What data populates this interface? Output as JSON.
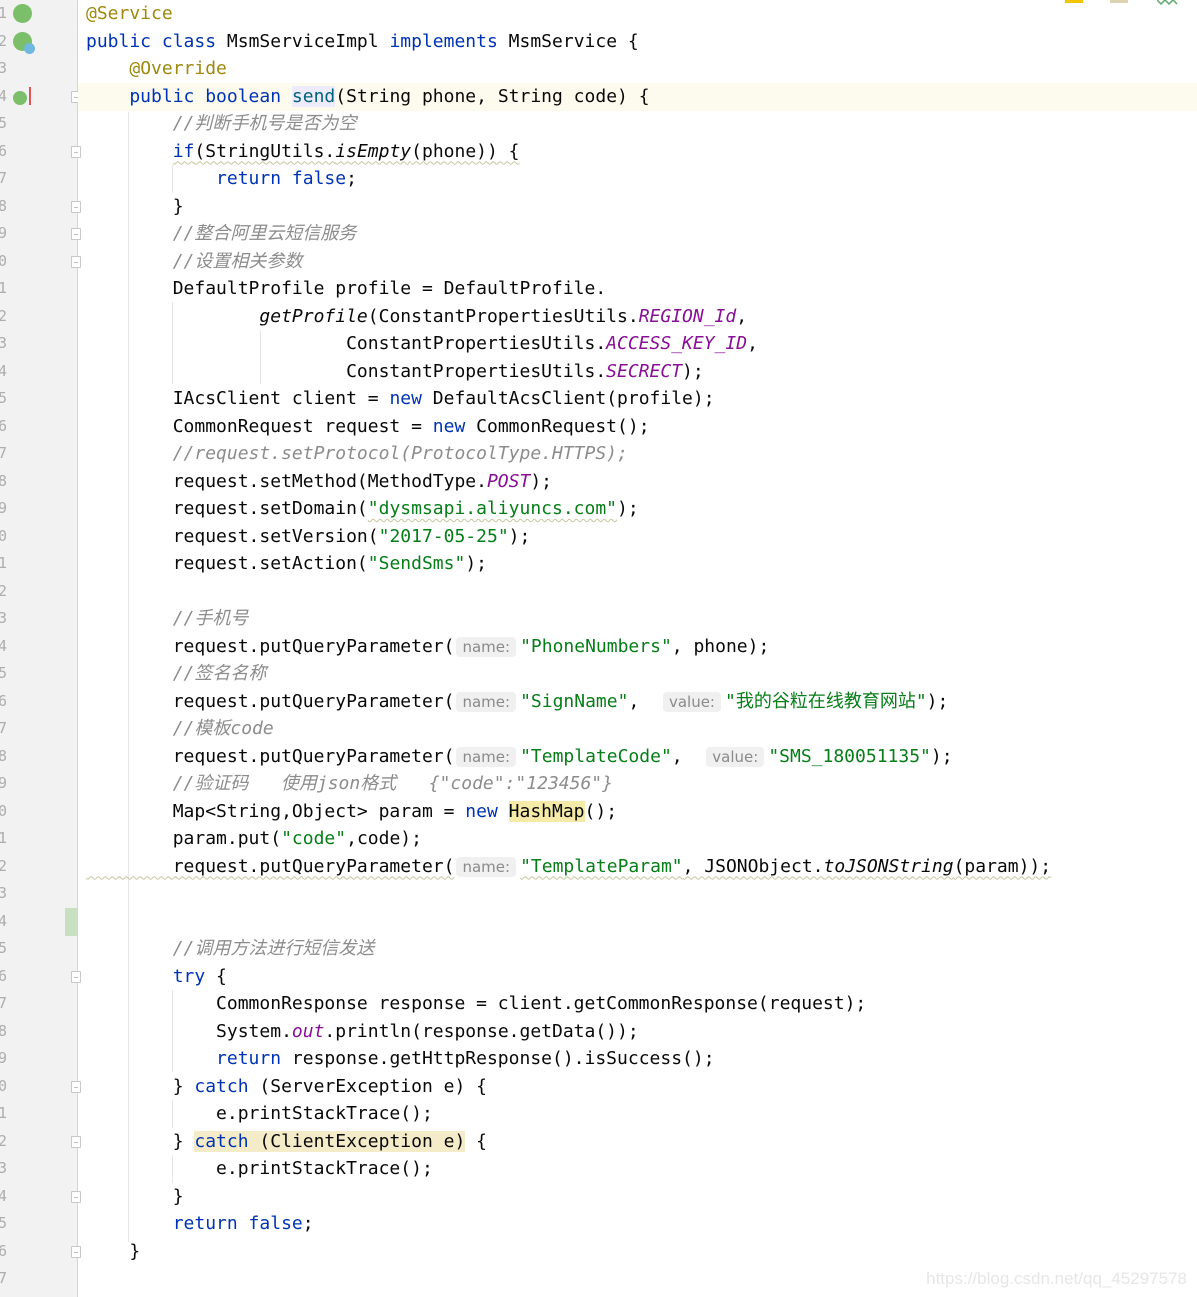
{
  "editor": {
    "line_number_digits": [
      "1",
      "2",
      "3",
      "4",
      "5",
      "6",
      "7",
      "8",
      "9",
      "0",
      "1",
      "2",
      "3",
      "4",
      "5",
      "6",
      "7",
      "8",
      "9",
      "0",
      "1",
      "2",
      "3",
      "4",
      "5",
      "6",
      "7",
      "8",
      "9",
      "0",
      "1",
      "2",
      "3",
      "4",
      "5",
      "6",
      "7",
      "8",
      "9",
      "0",
      "1",
      "2",
      "3",
      "4",
      "5",
      "6",
      "7"
    ],
    "gutter_icons": [
      "spring-bean-icon",
      "spring-class-icon",
      "implements-method-icon"
    ],
    "lines": [
      [
        [
          "@Service",
          "a"
        ]
      ],
      [
        [
          "public class ",
          "k"
        ],
        [
          "MsmServiceImpl ",
          ""
        ],
        [
          "implements ",
          "k"
        ],
        [
          "MsmService {",
          ""
        ]
      ],
      [
        [
          "    ",
          " "
        ],
        [
          "@Override",
          "a"
        ]
      ],
      [
        [
          "    public boolean ",
          "k"
        ],
        [
          "send",
          "m hl-send"
        ],
        [
          "(String phone, String code) {",
          ""
        ]
      ],
      [
        [
          "        //判断手机号是否为空",
          "c"
        ]
      ],
      [
        [
          "        ",
          " "
        ],
        [
          "if",
          "k wavy"
        ],
        [
          "(StringUtils.",
          "wavy"
        ],
        [
          "isEmpty",
          "i wavy"
        ],
        [
          "(phone)) {",
          "wavy"
        ]
      ],
      [
        [
          "            return false",
          "k"
        ],
        [
          ";",
          ""
        ]
      ],
      [
        [
          "        }",
          ""
        ]
      ],
      [
        [
          "        //整合阿里云短信服务",
          "c"
        ]
      ],
      [
        [
          "        //设置相关参数",
          "c"
        ]
      ],
      [
        [
          "        DefaultProfile profile = DefaultProfile.",
          ""
        ]
      ],
      [
        [
          "                ",
          " "
        ],
        [
          "getProfile",
          "i"
        ],
        [
          "(ConstantPropertiesUtils.",
          ""
        ],
        [
          "REGION_Id",
          "f"
        ],
        [
          ",",
          ""
        ]
      ],
      [
        [
          "                        ConstantPropertiesUtils.",
          ""
        ],
        [
          "ACCESS_KEY_ID",
          "f"
        ],
        [
          ",",
          ""
        ]
      ],
      [
        [
          "                        ConstantPropertiesUtils.",
          ""
        ],
        [
          "SECRECT",
          "f"
        ],
        [
          ");",
          ""
        ]
      ],
      [
        [
          "        IAcsClient client = ",
          ""
        ],
        [
          "new ",
          "k"
        ],
        [
          "DefaultAcsClient(profile);",
          ""
        ]
      ],
      [
        [
          "        CommonRequest request = ",
          ""
        ],
        [
          "new ",
          "k"
        ],
        [
          "CommonRequest();",
          ""
        ]
      ],
      [
        [
          "        //request.setProtocol(ProtocolType.HTTPS);",
          "c"
        ]
      ],
      [
        [
          "        request.setMethod(MethodType.",
          ""
        ],
        [
          "POST",
          "f"
        ],
        [
          ");",
          ""
        ]
      ],
      [
        [
          "        request.setDomain(",
          ""
        ],
        [
          "\"dysmsapi.aliyuncs.com\"",
          "s wavy"
        ],
        [
          ");",
          ""
        ]
      ],
      [
        [
          "        request.setVersion(",
          ""
        ],
        [
          "\"2017-05-25\"",
          "s"
        ],
        [
          ");",
          ""
        ]
      ],
      [
        [
          "        request.setAction(",
          ""
        ],
        [
          "\"SendSms\"",
          "s"
        ],
        [
          ");",
          ""
        ]
      ],
      [],
      [
        [
          "        //手机号",
          "c"
        ]
      ],
      [
        [
          "        request.putQueryParameter(",
          ""
        ],
        [
          "name:",
          "h"
        ],
        [
          "\"PhoneNumbers\"",
          "s"
        ],
        [
          ", phone);",
          ""
        ]
      ],
      [
        [
          "        //签名名称",
          "c"
        ]
      ],
      [
        [
          "        request.putQueryParameter(",
          ""
        ],
        [
          "name:",
          "h"
        ],
        [
          "\"SignName\"",
          "s"
        ],
        [
          ",  ",
          ""
        ],
        [
          "value:",
          "h"
        ],
        [
          "\"我的谷粒在线教育网站\"",
          "s"
        ],
        [
          ");",
          ""
        ]
      ],
      [
        [
          "        //模板code",
          "c"
        ]
      ],
      [
        [
          "        request.putQueryParameter(",
          ""
        ],
        [
          "name:",
          "h"
        ],
        [
          "\"TemplateCode\"",
          "s"
        ],
        [
          ",  ",
          ""
        ],
        [
          "value:",
          "h"
        ],
        [
          "\"SMS_180051135\"",
          "s"
        ],
        [
          ");",
          ""
        ]
      ],
      [
        [
          "        //验证码   使用json格式   {\"code\":\"123456\"}",
          "c"
        ]
      ],
      [
        [
          "        Map<String,Object> param = ",
          ""
        ],
        [
          "new ",
          "k"
        ],
        [
          "HashMap",
          "hl-y"
        ],
        [
          "();",
          ""
        ]
      ],
      [
        [
          "        param.put(",
          ""
        ],
        [
          "\"code\"",
          "s"
        ],
        [
          ",code);",
          ""
        ]
      ],
      [
        [
          "        request.putQueryParameter(",
          "wavy"
        ],
        [
          "name:",
          "h"
        ],
        [
          "\"TemplateParam\"",
          "s wavy"
        ],
        [
          ", JSONObject.",
          "wavy"
        ],
        [
          "toJSONString",
          "i wavy"
        ],
        [
          "(param));",
          "wavy"
        ]
      ],
      [],
      [],
      [
        [
          "        //调用方法进行短信发送",
          "c"
        ]
      ],
      [
        [
          "        try ",
          "k"
        ],
        [
          "{",
          ""
        ]
      ],
      [
        [
          "            CommonResponse response = client.getCommonResponse(request);",
          ""
        ]
      ],
      [
        [
          "            System.",
          ""
        ],
        [
          "out",
          "fi"
        ],
        [
          ".println(response.getData());",
          ""
        ]
      ],
      [
        [
          "            return ",
          "k"
        ],
        [
          "response.getHttpResponse().isSuccess();",
          ""
        ]
      ],
      [
        [
          "        } ",
          ""
        ],
        [
          "catch ",
          "k"
        ],
        [
          "(ServerException e) {",
          ""
        ]
      ],
      [
        [
          "            e.printStackTrace();",
          ""
        ]
      ],
      [
        [
          "        } ",
          ""
        ],
        [
          "catch",
          "k hl-c"
        ],
        [
          " (ClientException e)",
          "hl-c"
        ],
        [
          " {",
          ""
        ]
      ],
      [
        [
          "            e.printStackTrace();",
          ""
        ]
      ],
      [
        [
          "        }",
          ""
        ]
      ],
      [
        [
          "        return false",
          "k"
        ],
        [
          ";",
          ""
        ]
      ],
      [
        [
          "    }",
          ""
        ]
      ]
    ]
  },
  "colors": {
    "keyword": "#0033b3",
    "annotation": "#9e880d",
    "string": "#067d17",
    "comment": "#8c8c8c",
    "static_field": "#871094",
    "method_decl": "#00627a"
  },
  "watermark": "https://blog.csdn.net/qq_45297578"
}
